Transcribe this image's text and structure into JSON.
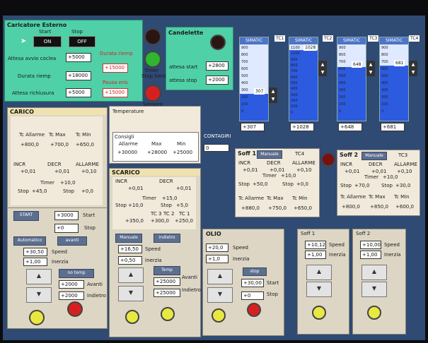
{
  "caricatore": {
    "title": "Caricatore Esterno",
    "start_label": "Start",
    "stop_label": "Stop",
    "on_btn": "ON",
    "off_btn": "OFF",
    "attesa_avvio_label": "Attesa avvio coclea",
    "attesa_avvio_value": "+5000",
    "durata_riemp_label": "Durata riemp",
    "durata_riemp_value": "+18000",
    "attesa_richiusura_label": "Attesa richiusura",
    "attesa_richiusura_value": "+5000",
    "durata_riemp_red_label": "Durata riemp",
    "durata_riemp_red_value": "+15000",
    "pausa_eris_label": "Pausa eris",
    "pausa_eris_value": "+15000",
    "timer_label": "Timer",
    "stop_sensore_label": "Stop Sensore",
    "sensore_label": "Sensore"
  },
  "candelette": {
    "title": "Candelette",
    "attesa_start_label": "attesa start",
    "attesa_start_value": "+2800",
    "attesa_stop_label": "attesa stop",
    "attesa_stop_value": "+2000"
  },
  "tanks": [
    {
      "title": "SIMATIC",
      "tc": "TC1",
      "value": "+307",
      "top": "1000",
      "readout": "307",
      "fill": 0.35,
      "scale": [
        "900",
        "800",
        "700",
        "600",
        "500",
        "400",
        "300",
        "200",
        "100",
        "0"
      ]
    },
    {
      "title": "SIMATIC",
      "tc": "TC2",
      "value": "+1028",
      "top": "1100",
      "readout": "1028",
      "fill": 0.93,
      "scale": [
        "1100",
        "1000",
        "900",
        "800",
        "700",
        "600",
        "500",
        "400",
        "300",
        "200",
        "100",
        "0"
      ]
    },
    {
      "title": "SIMATIC",
      "tc": "TC3",
      "value": "+648",
      "top": "900",
      "readout": "648",
      "fill": 0.7,
      "scale": [
        "900",
        "800",
        "700",
        "600",
        "500",
        "400",
        "300",
        "200",
        "100",
        "0"
      ]
    },
    {
      "title": "SIMATIC",
      "tc": "TC4",
      "value": "+681",
      "top": "900",
      "readout": "681",
      "fill": 0.72,
      "scale": [
        "900",
        "800",
        "700",
        "600",
        "500",
        "400",
        "300",
        "200",
        "100",
        "0"
      ]
    }
  ],
  "carico": {
    "title": "CARICO",
    "cols": [
      "Tc Allarme",
      "Tc Max",
      "Tc Min"
    ],
    "vals": [
      "+800,0",
      "+700,0",
      "+650,0"
    ],
    "incr": "INCR",
    "decr": "DECR",
    "allarme": "ALLARME",
    "incr_v": "+0,01",
    "decr_v": "+0,01",
    "allarme_v": "+0,10",
    "timer": "Timer",
    "timer_v": "+10,0",
    "stop_label": "Stop",
    "stop_v": "+45,0",
    "stop2_label": "Stop",
    "stop2_v": "+0,0",
    "start_btn": "START",
    "start_value": "+3000",
    "start_label": "Start",
    "stop_value": "+0",
    "stop_text": "Stop",
    "auto_btn": "Automatico",
    "avanti_btn": "avanti",
    "speed_value": "+30,50",
    "speed_label": "Speed",
    "inerzia_value": "+1,00",
    "inerzia_label": "Inerzia",
    "nostop_btn": "no temp",
    "avanti_value": "+2000",
    "avanti_label": "Avanti",
    "indietro_value": "+2000",
    "indietro_label": "Indietro"
  },
  "temperature": {
    "title": "Temperature",
    "consigli": "Consigli",
    "allarme_label": "Allarme",
    "max_label": "Max",
    "min_label": "Min",
    "allarme_v": "+30000",
    "max_v": "+28000",
    "min_v": "+25000"
  },
  "contagiri": {
    "title": "CONTAGIRI",
    "value": "0"
  },
  "scarico": {
    "title": "SCARICO",
    "incr": "INCR",
    "decr": "DECR",
    "incr_v": "+0,01",
    "decr_v": "+0,01",
    "timer": "Timer",
    "timer_v": "+15,0",
    "stop_label": "Stop",
    "stop_v": "+10,0",
    "stop2_label": "Stop",
    "stop2_v": "+5,0",
    "tc_labels": [
      "TC 3",
      "TC 2",
      "TC 1"
    ],
    "tc_vals": [
      "+350,0",
      "+300,0",
      "+250,0"
    ],
    "manuale_btn": "Manuale",
    "indietro_btn": "indietro",
    "speed_value": "+16,50",
    "speed_label": "Speed",
    "inerzia_value": "+0,50",
    "inerzia_label": "Inerzia",
    "temp_btn": "Temp",
    "avanti_value": "+25000",
    "avanti_label": "Avanti",
    "indietro_value": "+25000",
    "indietro_label": "Indietro"
  },
  "soff1": {
    "title": "Soff 1",
    "manuale_btn": "Manuale",
    "tc_label": "TC4",
    "incr": "INCR",
    "decr": "DECR",
    "allarme": "ALLARME",
    "incr_v": "+0,01",
    "decr_v": "+0,01",
    "allarme_v": "+0,10",
    "timer": "Timer",
    "timer_v": "+10,0",
    "stop_label": "Stop",
    "stop_v": "+50,0",
    "stop2_label": "Stop",
    "stop2_v": "+0,0",
    "cols": [
      "Tc Allarme",
      "Tc Max",
      "Tc Min"
    ],
    "vals": [
      "+880,0",
      "+750,0",
      "+650,0"
    ]
  },
  "soff2": {
    "title": "Soff 2",
    "manuale_btn": "Manuale",
    "tc_label": "TC3",
    "incr": "INCR",
    "decr": "DECR",
    "allarme": "ALLARME",
    "incr_v": "+0,01",
    "decr_v": "+0,01",
    "allarme_v": "+0,10",
    "timer": "Timer",
    "timer_v": "+10,0",
    "stop_label": "Stop",
    "stop_v": "+70,0",
    "stop2_label": "Stop",
    "stop2_v": "+30,0",
    "cols": [
      "Tc Allarme",
      "Tc Max",
      "Tc Min"
    ],
    "vals": [
      "+800,0",
      "+850,0",
      "+600,0"
    ]
  },
  "olio": {
    "title": "OLIO",
    "speed_value": "+20,0",
    "speed_label": "Speed",
    "inerzia_value": "+1,0",
    "inerzia_label": "Inerzia",
    "stop_btn": "stop",
    "start_value": "+30,00",
    "start_label": "Start",
    "stop_value": "+0",
    "stop_label": "Stop"
  },
  "soff1_lower": {
    "title": "Soff 1",
    "speed_value": "+10,12",
    "speed_label": "Speed",
    "inerzia_value": "+1,00",
    "inerzia_label": "Inerzia"
  },
  "soff2_lower": {
    "title": "Soff 2",
    "speed_value": "+10,00",
    "speed_label": "Speed",
    "inerzia_value": "+1,00",
    "inerzia_label": "Inerzia"
  },
  "colors": {
    "screen_bg": "#2f4a73",
    "panel_bg": "#ddd6c4",
    "green_panel": "#4fd0a6",
    "lamp_red": "#d62020",
    "lamp_green": "#2fb52f",
    "lamp_yellow": "#e8e840",
    "tank_fill": "#2c5be0"
  }
}
